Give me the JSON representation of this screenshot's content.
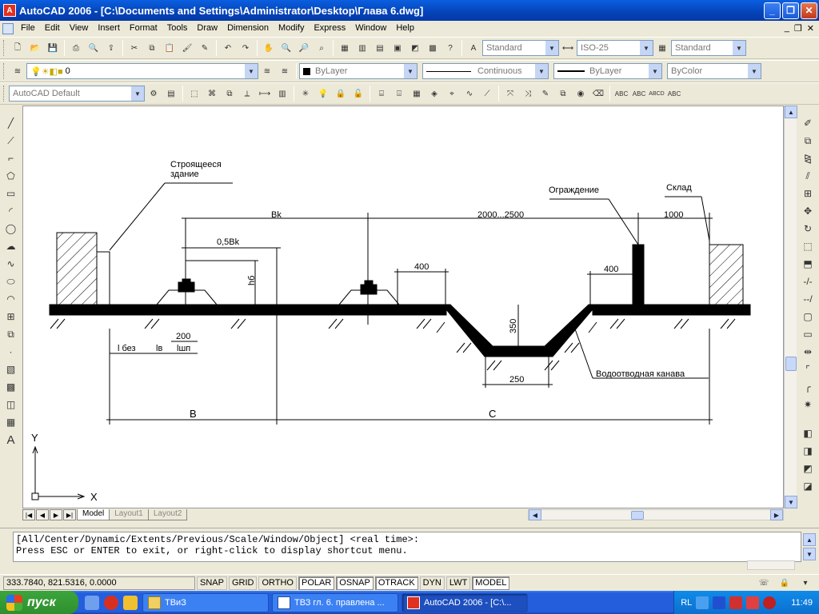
{
  "window": {
    "title": "AutoCAD 2006 - [C:\\Documents and Settings\\Administrator\\Desktop\\Глава 6.dwg]"
  },
  "menu": [
    "File",
    "Edit",
    "View",
    "Insert",
    "Format",
    "Tools",
    "Draw",
    "Dimension",
    "Modify",
    "Express",
    "Window",
    "Help"
  ],
  "toolbar": {
    "text_style": "Standard",
    "dim_style": "ISO-25",
    "table_style": "Standard",
    "layer_name": "0",
    "color": "ByLayer",
    "linetype": "Continuous",
    "lineweight": "ByLayer",
    "plotstyle": "ByColor",
    "workspace": "AutoCAD Default"
  },
  "drawing": {
    "labels": {
      "building": "Строящееся",
      "building2": "здание",
      "fence": "Ограждение",
      "warehouse": "Склад",
      "bk": "Bk",
      "range": "2000...2500",
      "d1000": "1000",
      "half_bk": "0,5Bk",
      "d400a": "400",
      "d400b": "400",
      "hb": "hб",
      "d200": "200",
      "lbez": "l без",
      "lv": "lв",
      "lsh": "lшп",
      "d350": "350",
      "d250": "250",
      "ditch": "Водоотводная канава",
      "B": "B",
      "C": "C",
      "axis_x": "X",
      "axis_y": "Y"
    }
  },
  "layout_tabs": [
    "Model",
    "Layout1",
    "Layout2"
  ],
  "command": {
    "line1": "[All/Center/Dynamic/Extents/Previous/Scale/Window/Object] <real time>:",
    "line2": "Press ESC or ENTER to exit, or right-click to display shortcut menu."
  },
  "status": {
    "coords": "333.7840, 821.5316, 0.0000",
    "buttons": [
      "SNAP",
      "GRID",
      "ORTHO",
      "POLAR",
      "OSNAP",
      "OTRACK",
      "DYN",
      "LWT",
      "MODEL"
    ]
  },
  "taskbar": {
    "start": "пуск",
    "tasks": [
      "ТВиЗ",
      "ТВЗ гл. 6. правлена ...",
      "AutoCAD 2006 - [C:\\..."
    ],
    "lang": "RL",
    "clock": "11:49"
  }
}
